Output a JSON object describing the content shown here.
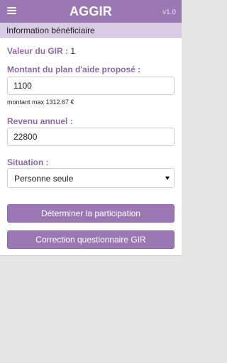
{
  "header": {
    "menu_icon": "hamburger-menu-icon",
    "title": "AGGIR",
    "version": "v1.0",
    "color": "#9b78b3"
  },
  "subheader": {
    "label": "Information bénéficiaire",
    "color": "#d9cbe3"
  },
  "form": {
    "gir_label": "Valeur du GIR :",
    "gir_value": "1",
    "plan_label": "Montant du plan d'aide proposé :",
    "plan_value": "1100",
    "plan_hint": "montant max 1312.67 €",
    "revenue_label": "Revenu annuel :",
    "revenue_value": "22800",
    "situation_label": "Situation :",
    "situation_value": "Personne seule"
  },
  "buttons": {
    "participation": "Déterminer la participation",
    "correction": "Correction questionnaire GIR"
  }
}
